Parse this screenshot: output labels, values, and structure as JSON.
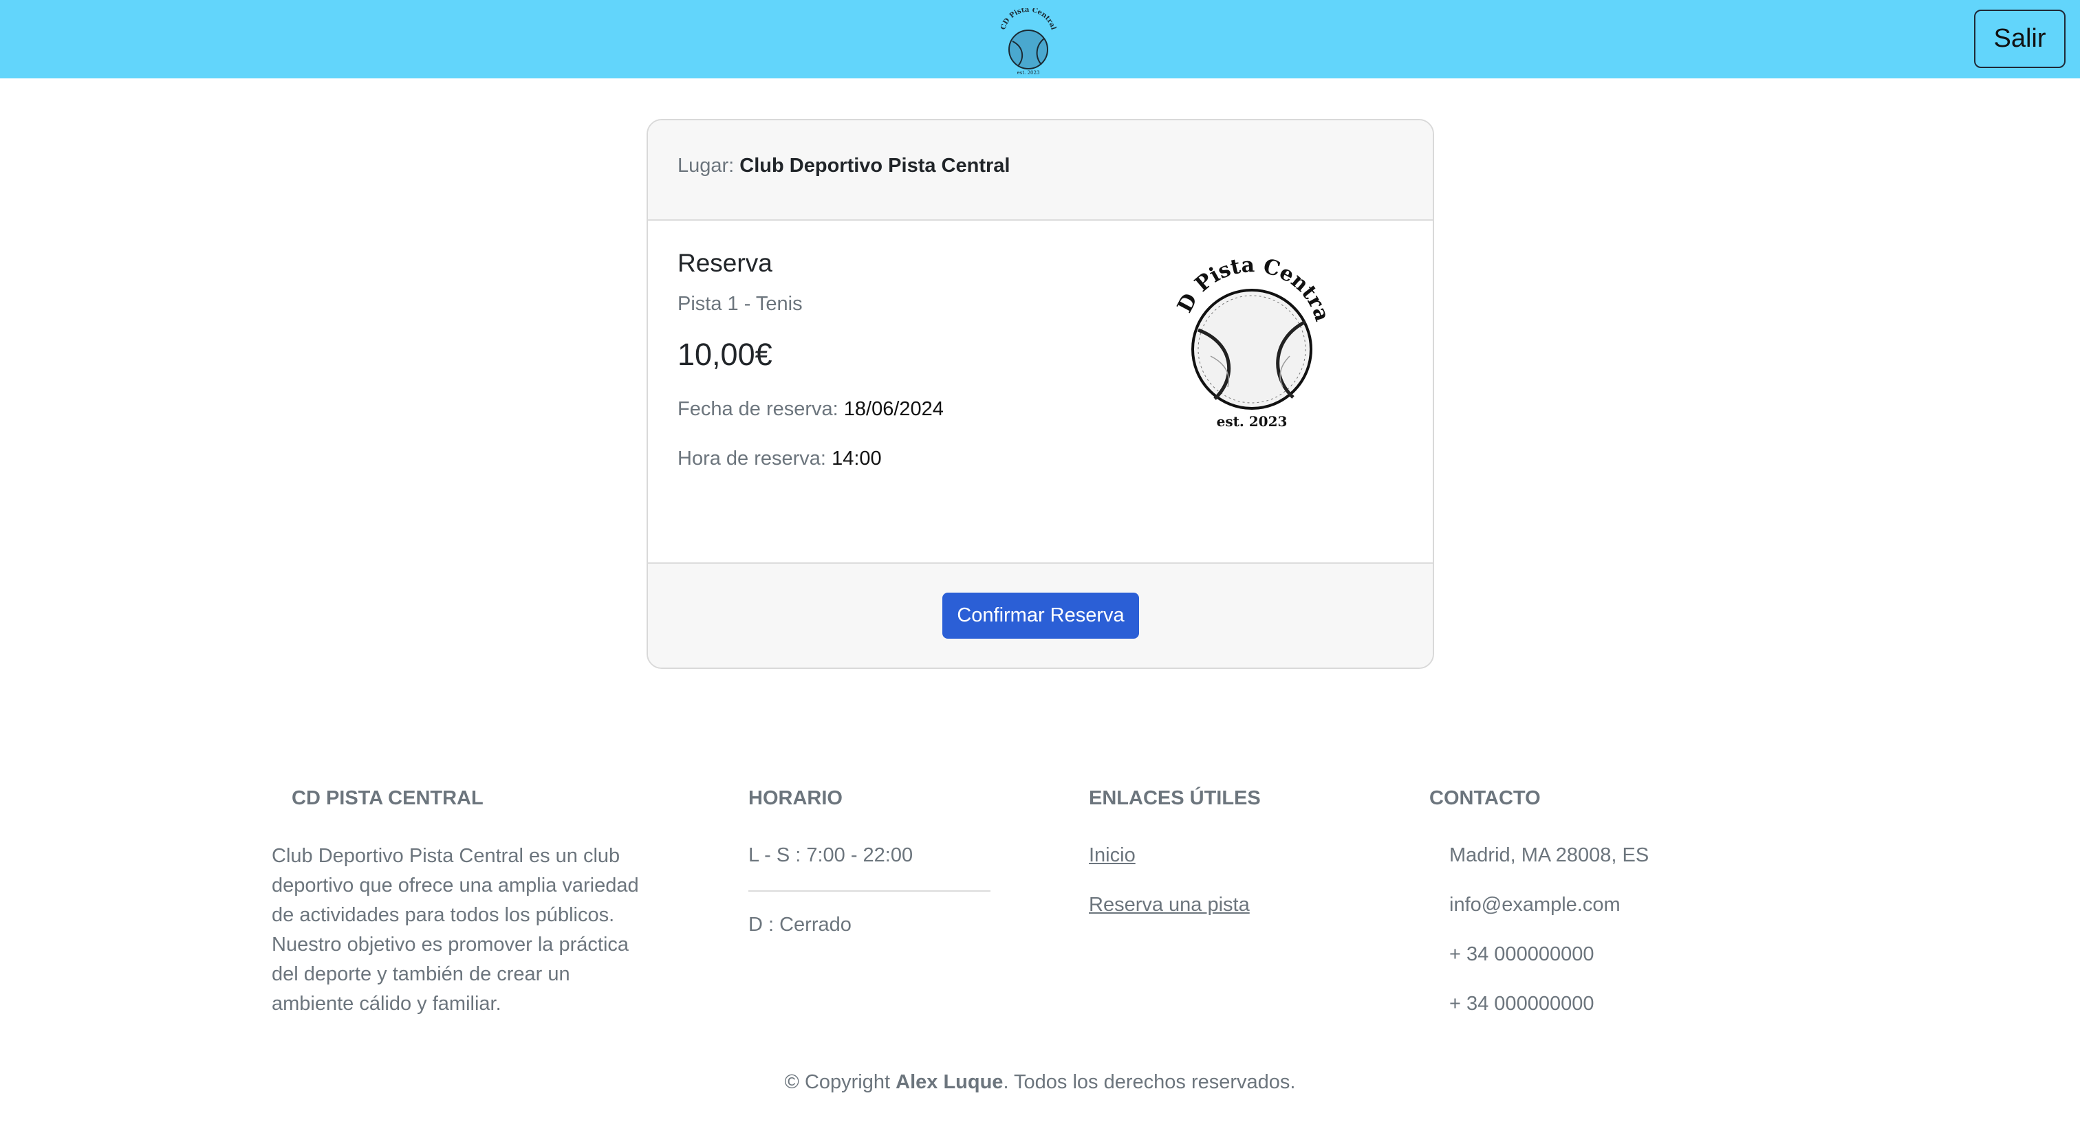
{
  "header": {
    "logo_alt": "CD Pista Central",
    "logo_text": "CD Pista Central",
    "logo_est": "est. 2023",
    "logout_label": "Salir"
  },
  "card": {
    "place_label": "Lugar:",
    "place_name": "Club Deportivo Pista Central",
    "title": "Reserva",
    "court": "Pista 1 - Tenis",
    "price": "10,00€",
    "date_label": "Fecha de reserva:",
    "date_value": "18/06/2024",
    "hour_label": "Hora de reserva:",
    "hour_value": "14:00",
    "confirm_label": "Confirmar Reserva"
  },
  "footer": {
    "club": {
      "heading": "CD PISTA CENTRAL",
      "text": "Club Deportivo Pista Central es un club deportivo que ofrece una amplia variedad de actividades para todos los públicos. Nuestro objetivo es promover la práctica del deporte y también de crear un ambiente cálido y familiar."
    },
    "schedule": {
      "heading": "HORARIO",
      "weekdays": "L - S : 7:00 - 22:00",
      "sunday": "D : Cerrado"
    },
    "links": {
      "heading": "ENLACES ÚTILES",
      "items": [
        "Inicio",
        "Reserva una pista"
      ]
    },
    "contact": {
      "heading": "CONTACTO",
      "address": "Madrid, MA 28008, ES",
      "email": "info@example.com",
      "phone1": "+ 34 000000000",
      "phone2": "+ 34 000000000"
    },
    "copyright_prefix": "© Copyright",
    "copyright_author": "Alex Luque",
    "copyright_suffix": ". Todos los derechos reservados."
  },
  "colors": {
    "header_bg": "#62d5fb",
    "primary_button": "#2b5fd6",
    "muted_text": "#6c757d"
  }
}
